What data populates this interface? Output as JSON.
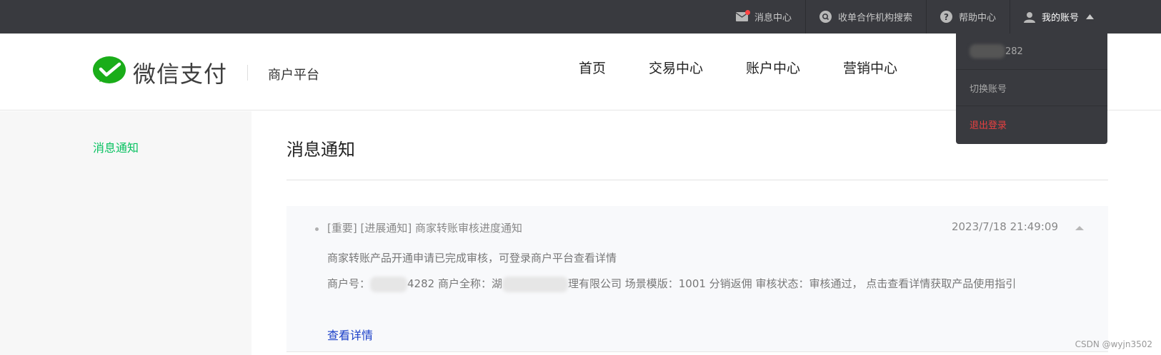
{
  "topbar": {
    "items": [
      {
        "label": "消息中心",
        "icon": "mail-icon"
      },
      {
        "label": "收单合作机构搜索",
        "icon": "search-icon"
      },
      {
        "label": "帮助中心",
        "icon": "help-icon"
      },
      {
        "label": "我的账号",
        "icon": "user-icon"
      }
    ]
  },
  "header": {
    "brand": "微信支付",
    "sub": "商户平台",
    "nav": [
      "首页",
      "交易中心",
      "账户中心",
      "营销中心"
    ]
  },
  "sidebar": {
    "active": "消息通知"
  },
  "main": {
    "title": "消息通知",
    "message": {
      "title": "[重要] [进展通知] 商家转账审核进度通知",
      "time": "2023/7/18 21:49:09",
      "line1": "商家转账产品开通申请已完成审核，可登录商户平台查看详情",
      "line2_a": "商户号：",
      "line2_b": "4282 商户全称：湖",
      "line2_c": "理有限公司 场景模版：1001 分销返佣 审核状态：审核通过， 点击查看详情获取产品使用指引",
      "detail_link": "查看详情"
    }
  },
  "dropdown": {
    "account_suffix": "282",
    "switch": "切换账号",
    "logout": "退出登录"
  },
  "watermark": "CSDN @wyjn3502",
  "colors": {
    "topbar": "#393a3f",
    "wechat_green": "#07c160",
    "link_blue": "#1a3fc8",
    "logout_red": "#e84040"
  }
}
